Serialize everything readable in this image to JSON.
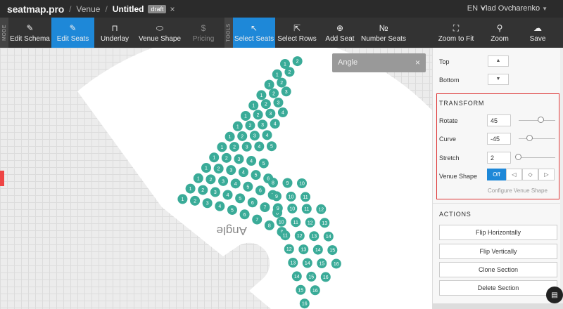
{
  "header": {
    "logo": "seatmap.pro",
    "breadcrumb": [
      "Venue",
      "Untitled"
    ],
    "draft_badge": "draft",
    "close_symbol": "×",
    "language": "EN",
    "user_name": "Vlad Ovcharenko"
  },
  "toolbar": {
    "mode_label": "MODE",
    "tools_label": "TOOLS",
    "mode_buttons": [
      {
        "label": "Edit Schema",
        "icon": "pencil-icon",
        "glyph": "✎"
      },
      {
        "label": "Edit Seats",
        "icon": "edit-seats-icon",
        "glyph": "✎",
        "active": true
      },
      {
        "label": "Underlay",
        "icon": "book-icon",
        "glyph": "⊓"
      },
      {
        "label": "Venue Shape",
        "icon": "shape-icon",
        "glyph": "⬭"
      },
      {
        "label": "Pricing",
        "icon": "price-icon",
        "glyph": "$",
        "disabled": true
      }
    ],
    "tool_buttons": [
      {
        "label": "Select Seats",
        "icon": "cursor-icon",
        "glyph": "↖",
        "active": true
      },
      {
        "label": "Select Rows",
        "icon": "cursor-rows-icon",
        "glyph": "⇱"
      },
      {
        "label": "Add Seat",
        "icon": "plus-circle-icon",
        "glyph": "⊕"
      },
      {
        "label": "Number Seats",
        "icon": "number-icon",
        "glyph": "№"
      }
    ],
    "view_buttons": [
      {
        "label": "Zoom to Fit",
        "icon": "fit-icon",
        "glyph": "⛶"
      },
      {
        "label": "Zoom",
        "icon": "zoom-icon",
        "glyph": "⚲"
      },
      {
        "label": "Save",
        "icon": "cloud-icon",
        "glyph": "☁"
      }
    ]
  },
  "canvas": {
    "section_label": "Angle",
    "tooltip_label": "Angle",
    "tooltip_close": "×",
    "seat_rows": [
      [
        1,
        2
      ],
      [
        1,
        2
      ],
      [
        1,
        2
      ],
      [
        1,
        2,
        3
      ],
      [
        1,
        2,
        3
      ],
      [
        1,
        2,
        3,
        4
      ],
      [
        1,
        2,
        3,
        4
      ],
      [
        1,
        2,
        3,
        4
      ],
      [
        1,
        2,
        3,
        4,
        5
      ],
      [
        1,
        2,
        3,
        4,
        5
      ],
      [
        1,
        2,
        3,
        4,
        5,
        6
      ],
      [
        1,
        2,
        3,
        4,
        5,
        6,
        7
      ],
      [
        1,
        2,
        3,
        4,
        5,
        6,
        7,
        8
      ],
      [
        1,
        2,
        3,
        4,
        5,
        6,
        7,
        8,
        9
      ],
      [
        8,
        9,
        10
      ],
      [
        9,
        10,
        11
      ],
      [
        9,
        10,
        11,
        12
      ],
      [
        10,
        11,
        12,
        13
      ],
      [
        11,
        12,
        13,
        14
      ],
      [
        12,
        13,
        14,
        15
      ],
      [
        13,
        14,
        15,
        16
      ],
      [
        14,
        15,
        16
      ],
      [
        15,
        16
      ],
      [
        16
      ]
    ],
    "colors": {
      "seat": "#3aab98",
      "venue_fill": "#ffffff",
      "seat_text": "#ffffff"
    }
  },
  "panel": {
    "top_label": "Top",
    "bottom_label": "Bottom",
    "up_arrow": "▲",
    "down_arrow": "▼",
    "transform_title": "TRANSFORM",
    "rotate_label": "Rotate",
    "rotate_value": "45",
    "curve_label": "Curve",
    "curve_value": "-45",
    "stretch_label": "Stretch",
    "stretch_value": "2",
    "venue_shape_label": "Venue Shape",
    "shape_off": "Off",
    "shape_opts": [
      "◁",
      "◇",
      "▷"
    ],
    "configure_label": "Configure Venue Shape",
    "actions_title": "ACTIONS",
    "actions": [
      "Flip Horizontally",
      "Flip Vertically",
      "Clone Section",
      "Delete Section"
    ],
    "accent_color": "#1e88d8",
    "highlight_color": "#dd3333"
  }
}
